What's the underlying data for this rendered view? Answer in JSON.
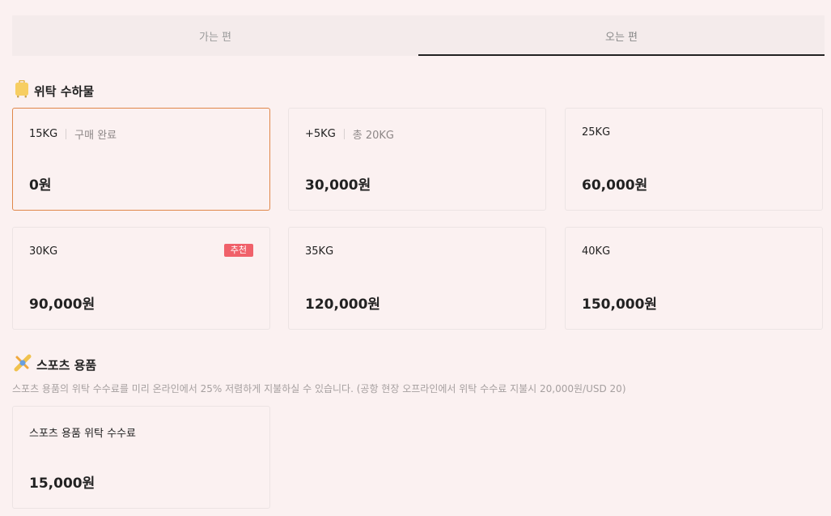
{
  "tabs": [
    {
      "label": "가는 편",
      "active": false
    },
    {
      "label": "오는 편",
      "active": true
    }
  ],
  "checked_baggage": {
    "title": "위탁 수하물",
    "icon": "suitcase-icon",
    "options": [
      {
        "weight": "15KG",
        "note": "구매 완료",
        "price": "0원",
        "selected": true
      },
      {
        "weight": "+5KG",
        "note": "총 20KG",
        "price": "30,000원"
      },
      {
        "weight": "25KG",
        "price": "60,000원"
      },
      {
        "weight": "30KG",
        "badge": "추천",
        "price": "90,000원"
      },
      {
        "weight": "35KG",
        "price": "120,000원"
      },
      {
        "weight": "40KG",
        "price": "150,000원"
      }
    ]
  },
  "sports_equipment": {
    "title": "스포츠 용품",
    "icon": "sports-equipment-icon",
    "description": "스포츠 용품의 위탁 수수료를 미리 온라인에서 25% 저렴하게 지불하실 수 있습니다. (공항 현장 오프라인에서 위탁 수수료 지불시 20,000원/USD 20)",
    "options": [
      {
        "label": "스포츠 용품 위탁 수수료",
        "price": "15,000원"
      }
    ]
  },
  "colors": {
    "background": "#fbf1f1",
    "selected_border": "#e0874a",
    "badge": "#f0616a"
  }
}
